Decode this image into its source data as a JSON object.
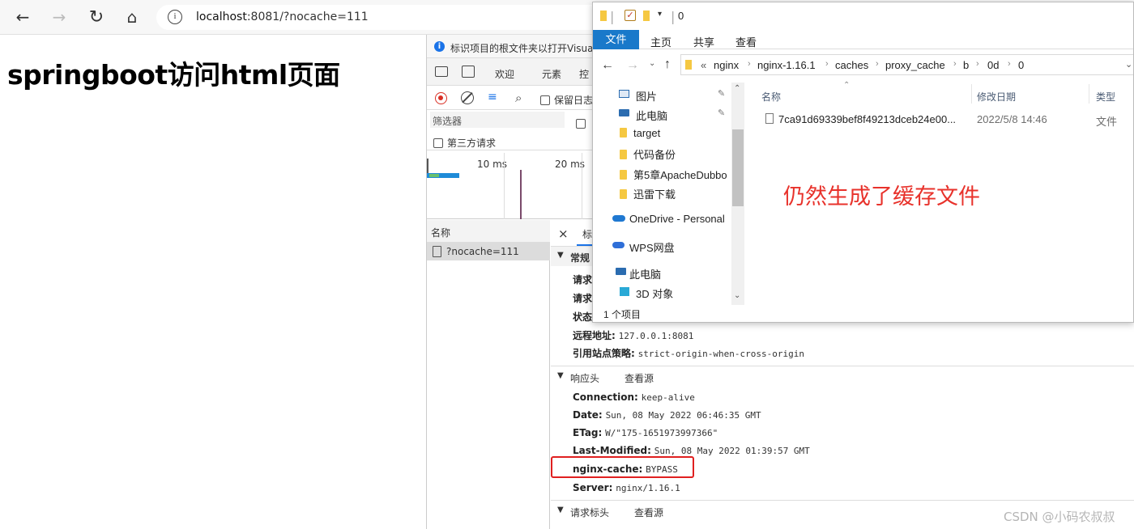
{
  "browser": {
    "back_glyph": "←",
    "forward_glyph": "→",
    "reload_glyph": "↻",
    "home_glyph": "⌂",
    "info_glyph": "i",
    "url_host": "localhost",
    "url_rest": ":8081/?nocache=111"
  },
  "page": {
    "heading": "springboot访问html页面"
  },
  "devtools": {
    "notice": "标识项目的根文件夹以打开Visua",
    "tabs": [
      "欢迎",
      "元素",
      "控"
    ],
    "preserve_log": "保留日志",
    "filter_placeholder": "筛选器",
    "third_party": "第三方请求",
    "timeline_ticks": [
      "10 ms",
      "20 ms"
    ],
    "name_column": "名称",
    "request_name": "?nocache=111",
    "close_glyph": "×",
    "detail_tab": "标",
    "general": {
      "title": "常规",
      "rows_truncated": [
        "请求",
        "请求",
        "状态"
      ],
      "remote_label": "远程地址:",
      "remote_value": "127.0.0.1:8081",
      "referrer_label": "引用站点策略:",
      "referrer_value": "strict-origin-when-cross-origin"
    },
    "response_headers": {
      "title": "响应头",
      "view_source": "查看源",
      "items": [
        {
          "key": "Connection:",
          "value": "keep-alive"
        },
        {
          "key": "Date:",
          "value": "Sun, 08 May 2022 06:46:35 GMT"
        },
        {
          "key": "ETag:",
          "value": "W/\"175-1651973997366\""
        },
        {
          "key": "Last-Modified:",
          "value": "Sun, 08 May 2022 01:39:57 GMT"
        },
        {
          "key": "nginx-cache:",
          "value": "BYPASS"
        },
        {
          "key": "Server:",
          "value": "nginx/1.16.1"
        }
      ]
    },
    "request_headers": {
      "title": "请求标头",
      "view_source": "查看源"
    }
  },
  "explorer": {
    "title_count": "0",
    "ribbon_tabs": [
      "文件",
      "主页",
      "共享",
      "查看"
    ],
    "breadcrumb_prefix": "«",
    "breadcrumb": [
      "nginx",
      "nginx-1.16.1",
      "caches",
      "proxy_cache",
      "b",
      "0d",
      "0"
    ],
    "nav_items": [
      {
        "label": "图片",
        "icon": "pictures-icon",
        "pinned": true
      },
      {
        "label": "此电脑",
        "icon": "computer-icon",
        "pinned": true
      },
      {
        "label": "target",
        "icon": "folder-icon",
        "pinned": false
      },
      {
        "label": "代码备份",
        "icon": "folder-icon",
        "pinned": false
      },
      {
        "label": "第5章ApacheDubbo",
        "icon": "folder-icon",
        "pinned": false
      },
      {
        "label": "迅雷下载",
        "icon": "folder-icon",
        "pinned": false
      },
      {
        "label": "OneDrive - Personal",
        "icon": "onedrive-icon",
        "pinned": false
      },
      {
        "label": "WPS网盘",
        "icon": "wps-cloud-icon",
        "pinned": false
      },
      {
        "label": "此电脑",
        "icon": "computer-icon",
        "pinned": false
      },
      {
        "label": "3D 对象",
        "icon": "3d-objects-icon",
        "pinned": false
      }
    ],
    "columns": [
      "名称",
      "修改日期",
      "类型"
    ],
    "file": {
      "name": "7ca91d69339bef8f49213dceb24e00...",
      "date": "2022/5/8 14:46",
      "type": "文件"
    },
    "annotation": "仍然生成了缓存文件",
    "annotation_color": "#e8322b",
    "status": "1 个项目"
  },
  "watermark": "CSDN @小码农叔叔",
  "highlight_color": "#e02020"
}
